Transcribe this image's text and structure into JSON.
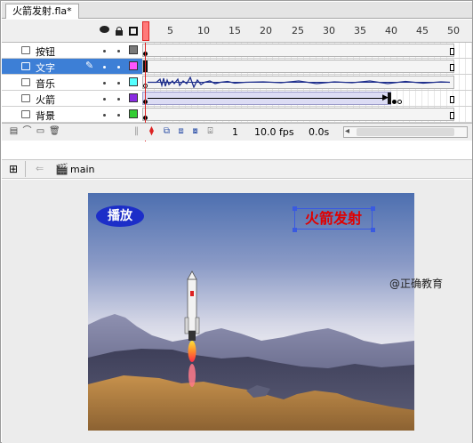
{
  "document_tab": {
    "label": "火箭发射.fla*"
  },
  "timeline": {
    "frame_numbers": [
      "1",
      "5",
      "10",
      "15",
      "20",
      "25",
      "30",
      "35",
      "40",
      "45",
      "50"
    ],
    "layers": [
      {
        "name": "按钮",
        "color": "#7a7a7a",
        "selected": false
      },
      {
        "name": "文字",
        "color": "#ff55ff",
        "selected": true
      },
      {
        "name": "音乐",
        "color": "#55ffff",
        "selected": false
      },
      {
        "name": "火箭",
        "color": "#8a2be2",
        "selected": false
      },
      {
        "name": "背景",
        "color": "#33cc33",
        "selected": false
      }
    ],
    "status": {
      "current_frame": "1",
      "frame_rate": "10.0 fps",
      "elapsed": "0.0s"
    }
  },
  "edit_bar": {
    "scene": "main"
  },
  "stage": {
    "play_button": "播放",
    "title": "火箭发射"
  },
  "watermark": "@正确教育",
  "colors": {
    "selection": "#3d7fd6",
    "playhead": "#d22222",
    "title_red": "#e00000",
    "button_blue": "#1c2ec8"
  }
}
